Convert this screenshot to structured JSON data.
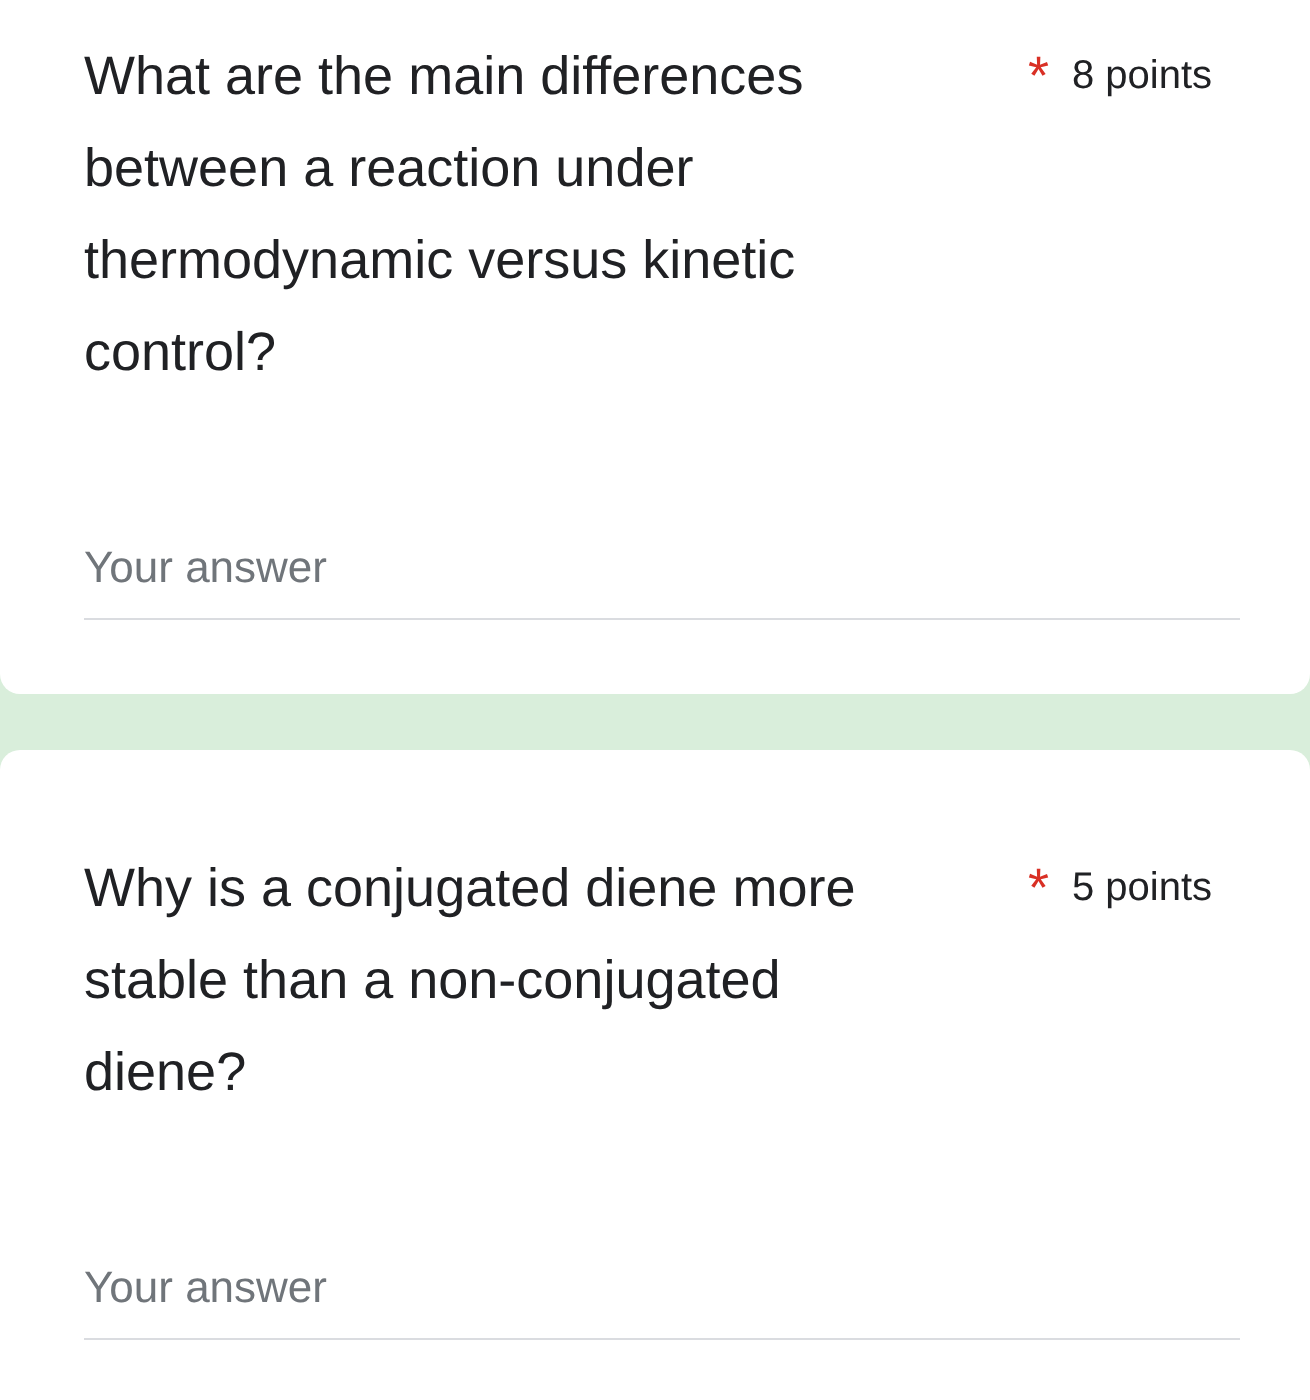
{
  "questions": [
    {
      "text": "What are the main differences between a reaction under thermodynamic versus kinetic control?",
      "required": true,
      "required_mark": "*",
      "points": "8 points",
      "answer": {
        "placeholder": "Your answer"
      }
    },
    {
      "text": "Why is a conjugated diene more stable than a non-conjugated diene?",
      "required": true,
      "required_mark": "*",
      "points": "5 points",
      "answer": {
        "placeholder": "Your answer"
      }
    }
  ]
}
